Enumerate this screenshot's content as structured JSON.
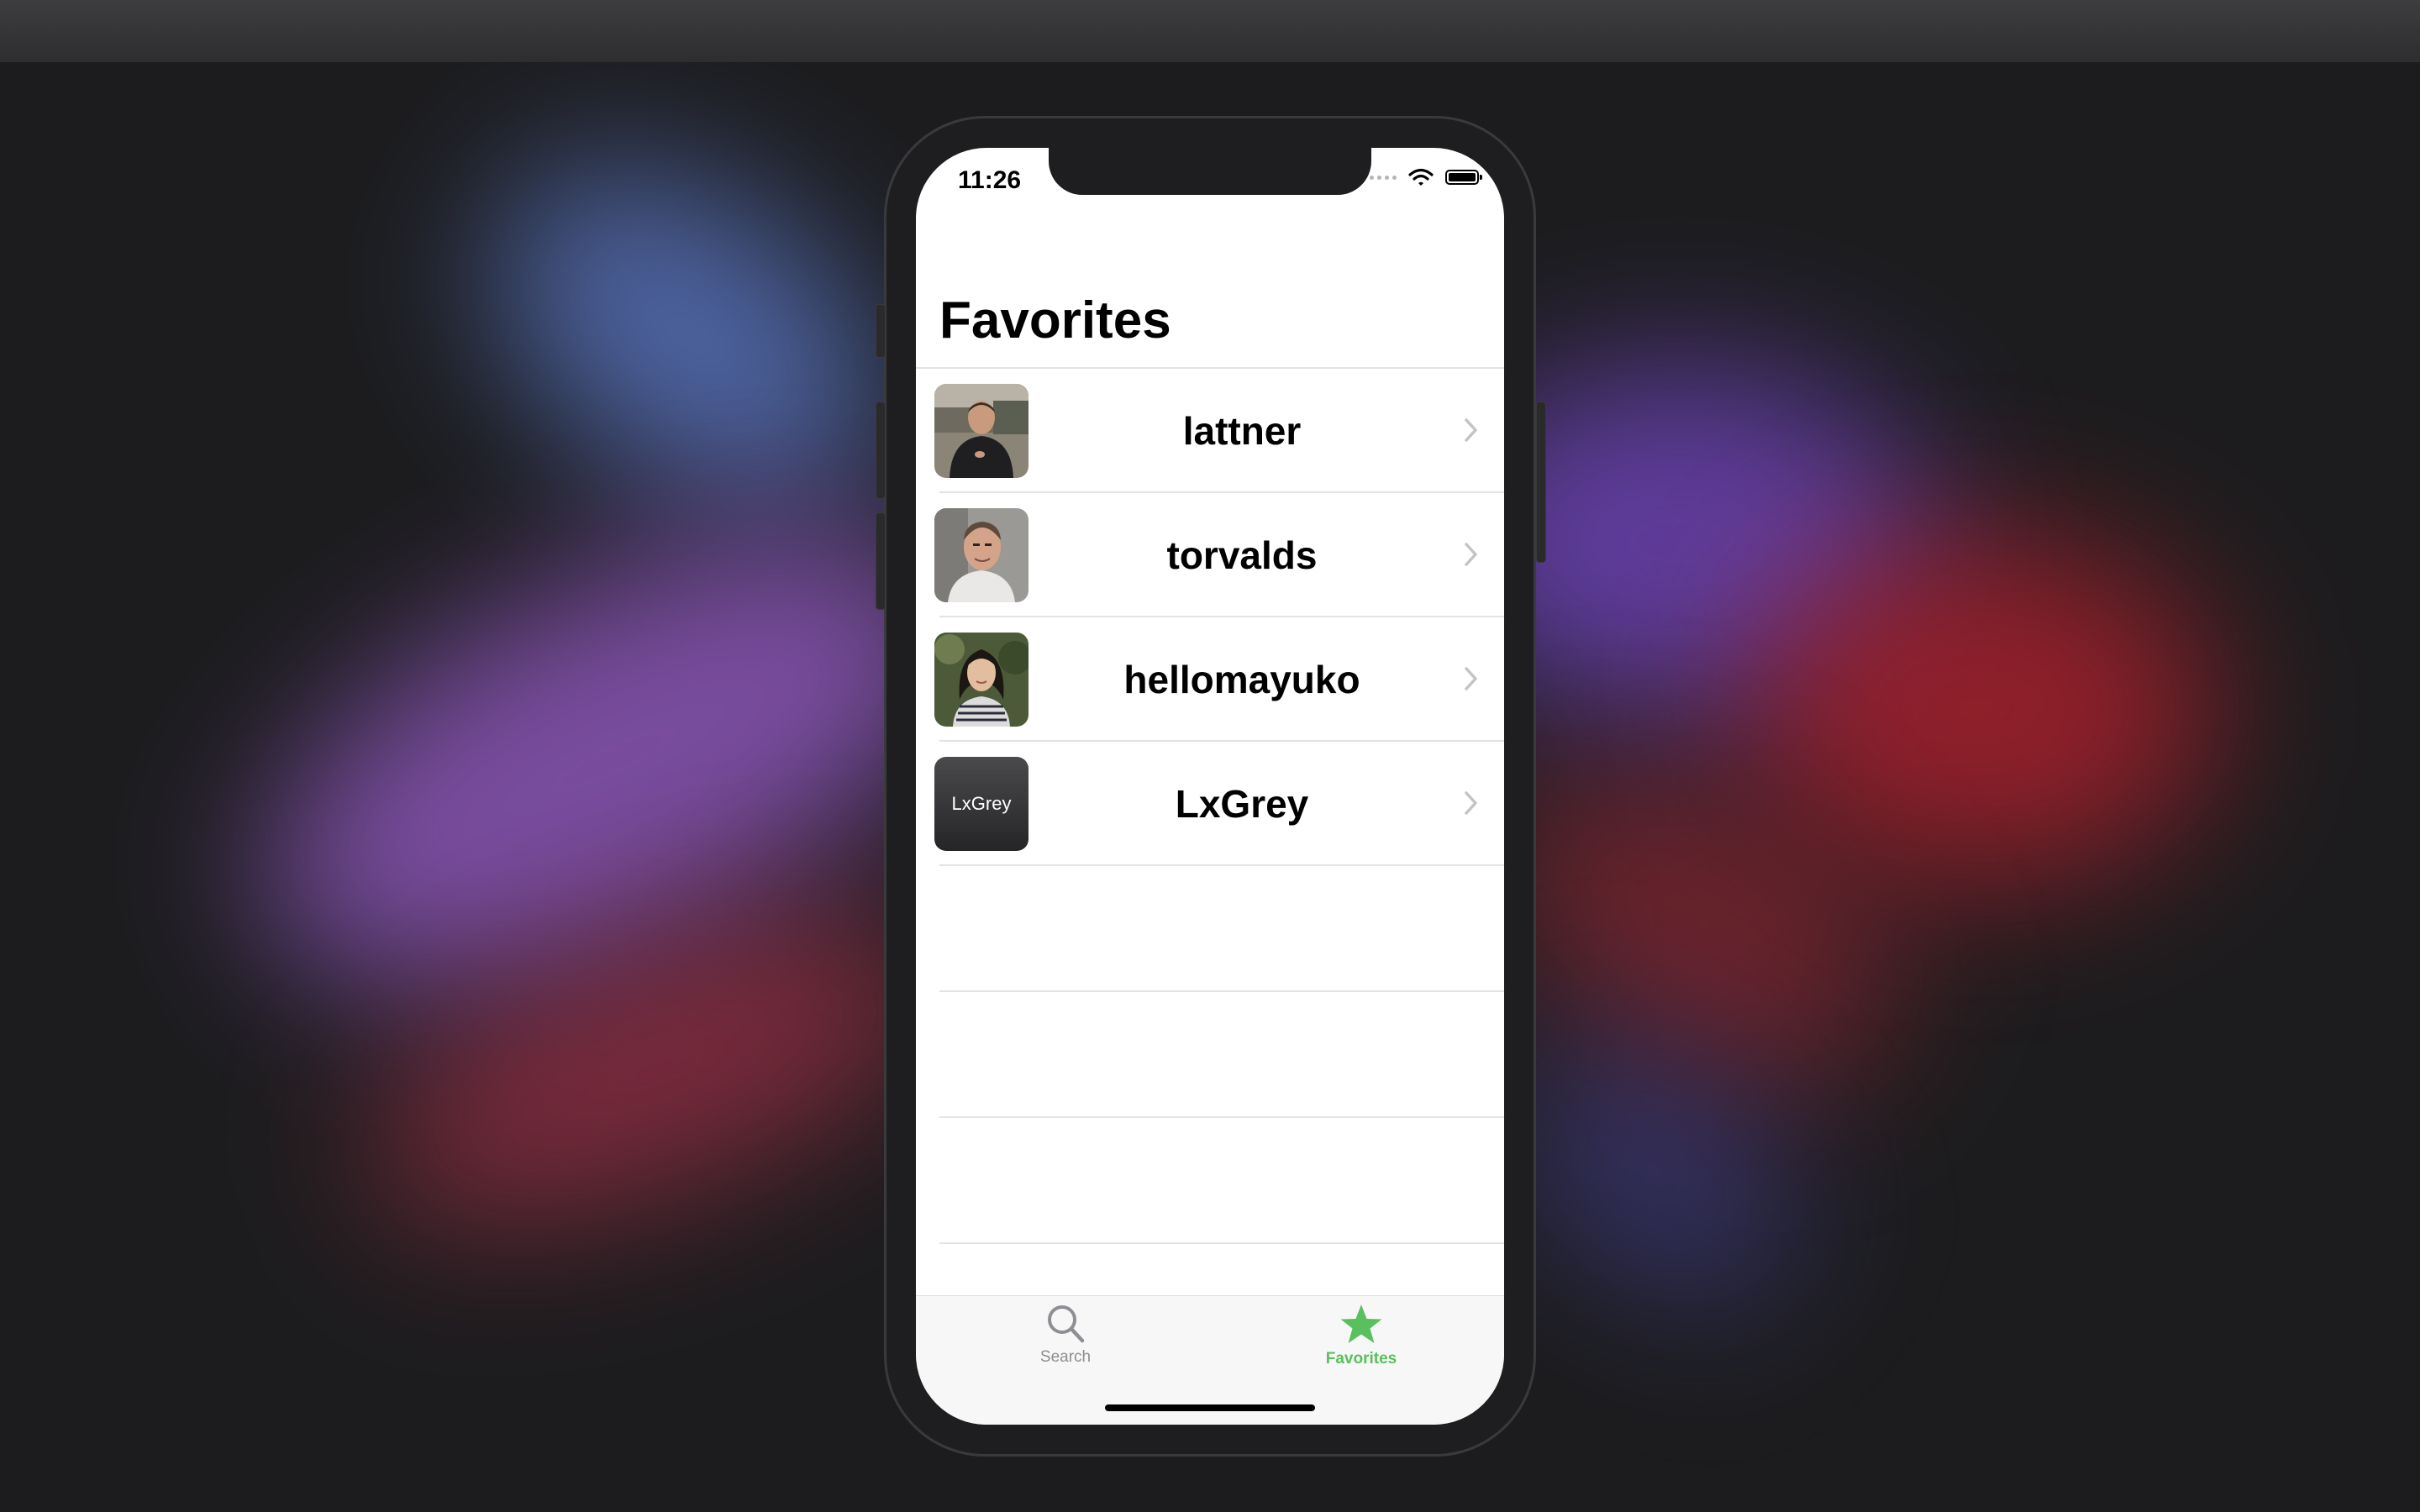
{
  "status_bar": {
    "time": "11:26",
    "icons": [
      "signal-dots-icon",
      "wifi-icon",
      "battery-icon"
    ]
  },
  "navigation": {
    "title": "Favorites"
  },
  "favorites": [
    {
      "username": "lattner",
      "avatar": "photo"
    },
    {
      "username": "torvalds",
      "avatar": "photo"
    },
    {
      "username": "hellomayuko",
      "avatar": "photo"
    },
    {
      "username": "LxGrey",
      "avatar": "text",
      "avatar_text": "LxGrey"
    }
  ],
  "tab_bar": {
    "tabs": [
      {
        "label": "Search",
        "icon": "magnifying-glass-icon",
        "selected": false
      },
      {
        "label": "Favorites",
        "icon": "star-icon",
        "selected": true
      }
    ]
  },
  "colors": {
    "accent": "#5ac05d",
    "inactive": "#8e8e93",
    "separator": "#e3e3e3",
    "chevron": "#c4c4c7"
  }
}
